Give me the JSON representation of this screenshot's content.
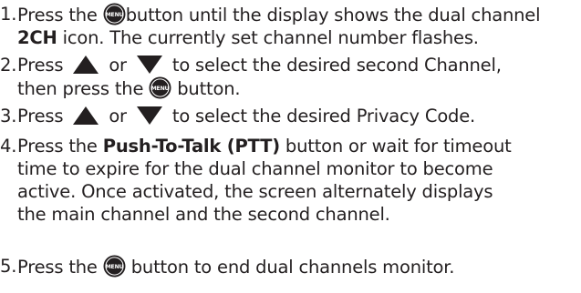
{
  "steps": [
    {
      "number": "1.",
      "pre": "Press the ",
      "icon": "menu-button-icon",
      "post_line1": "button until the display shows the dual channel",
      "bold": "2CH",
      "post_line2": " icon. The currently set channel number flashes."
    },
    {
      "number": "2.",
      "pre": "Press ",
      "icon_up": "up-arrow-icon",
      "or": " or ",
      "icon_down": "down-arrow-icon",
      "post_line1": " to select the desired second Channel,",
      "line2_pre": "then press the ",
      "icon": "menu-button-icon",
      "line2_post": " button."
    },
    {
      "number": "3.",
      "pre": "Press ",
      "icon_up": "up-arrow-icon",
      "or": " or ",
      "icon_down": "down-arrow-icon",
      "post": " to select the desired Privacy Code."
    },
    {
      "number": "4.",
      "pre": "Press the ",
      "bold": "Push-To-Talk (PTT)",
      "post_line1": " button or wait for timeout",
      "line2": "time to expire for the dual channel monitor to become",
      "line3": "active. Once activated,  the screen alternately displays",
      "line4": "the main channel and the second channel."
    },
    {
      "number": "5.",
      "pre": "Press the ",
      "icon": "menu-button-icon",
      "post": " button to end dual channels monitor."
    }
  ],
  "icon_label": "MENU",
  "colors": {
    "text": "#231f20",
    "icon": "#231f20",
    "icon_text": "#ffffff"
  }
}
